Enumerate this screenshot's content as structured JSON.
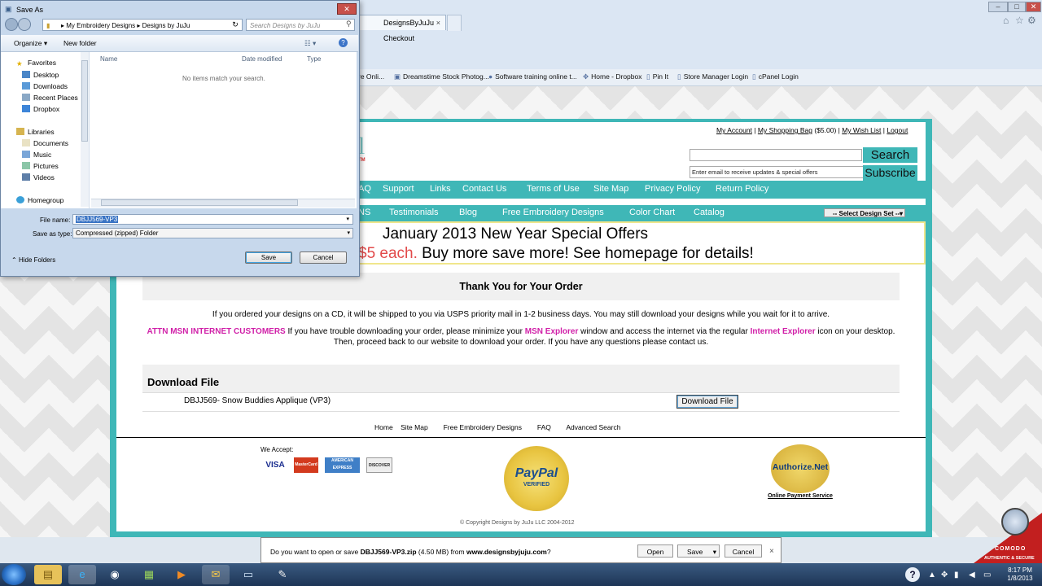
{
  "browser": {
    "tab_title": "DesignsByJuJu Checkout",
    "tab_close": "×",
    "favorites_bar": [
      "re Onli...",
      "Dreamstime Stock Photog...",
      "Software training online t...",
      "Home - Dropbox",
      "Pin It",
      "Store Manager Login",
      "cPanel Login"
    ]
  },
  "site": {
    "logo_fragment": "l",
    "logo_tm": "TM",
    "account_links": {
      "my_account": "My Account",
      "shopping_bag": "My Shopping Bag",
      "bag_total": "($5.00)",
      "wish_list": "My Wish List",
      "logout": "Logout"
    },
    "search_button": "Search",
    "email_placeholder": "Enter email to receive updates & special offers",
    "subscribe_button": "Subscribe",
    "nav1": [
      "AQ",
      "Support",
      "Links",
      "Contact Us",
      "Terms of Use",
      "Site Map",
      "Privacy Policy",
      "Return Policy"
    ],
    "nav2": [
      "NS",
      "Testimonials",
      "Blog",
      "Free Embroidery Designs",
      "Color Chart",
      "Catalog"
    ],
    "design_select": "-- Select Design Set --",
    "offer_line1": "January 2013 New Year Special Offers",
    "offer_line2_red": "$5 each.",
    "offer_line2": " Buy more save more! See homepage for details!"
  },
  "order": {
    "heading": "Thank You for Your Order",
    "cd_notice": "If you ordered your designs on a CD, it will be shipped to you via USPS priority mail in 1-2 business days. You may still download your designs while you wait for it to arrive.",
    "attn_label": "ATTN MSN INTERNET CUSTOMERS",
    "attn_text1": " If you have trouble downloading your order, please minimize your ",
    "msn_explorer": "MSN Explorer",
    "attn_text2": " window and access the internet via the regular ",
    "internet_explorer": "Internet Explorer",
    "attn_text3": " icon on your desktop. Then, proceed back to our website to download your order. If you have any questions please contact us.",
    "download_heading": "Download File",
    "download_item": "DBJJ569- Snow Buddies Applique (VP3)",
    "download_button": "Download File"
  },
  "footer": {
    "links": [
      "Home",
      "Site Map",
      "Free Embroidery Designs",
      "FAQ",
      "Advanced Search"
    ],
    "we_accept": "We Accept:",
    "cards": [
      "VISA",
      "MasterCard",
      "AMERICAN EXPRESS",
      "DISCOVER"
    ],
    "paypal": "PayPal",
    "paypal_verified": "VERIFIED",
    "authnet": "Authorize.Net",
    "authnet_caption": "Online Payment Service",
    "copyright": "© Copyright Designs by JuJu LLC 2004-2012"
  },
  "download_bar": {
    "prefix": "Do you want to open or save ",
    "filename": "DBJJ569-VP3.zip",
    "size": " (4.50 MB) from ",
    "domain": "www.designsbyjuju.com",
    "suffix": "?",
    "open": "Open",
    "save": "Save",
    "cancel": "Cancel",
    "close": "×"
  },
  "dialog": {
    "title": "Save As",
    "close": "✕",
    "path": [
      "My Embroidery Designs",
      "Designs by JuJu"
    ],
    "search_placeholder": "Search Designs by JuJu",
    "organize": "Organize ▾",
    "new_folder": "New folder",
    "nav": {
      "favorites": "Favorites",
      "desktop": "Desktop",
      "downloads": "Downloads",
      "recent": "Recent Places",
      "dropbox": "Dropbox",
      "libraries": "Libraries",
      "documents": "Documents",
      "music": "Music",
      "pictures": "Pictures",
      "videos": "Videos",
      "homegroup": "Homegroup"
    },
    "columns": [
      "Name",
      "Date modified",
      "Type"
    ],
    "empty_message": "No items match your search.",
    "file_name_label": "File name:",
    "file_name_value": "DBJJ569-VP3",
    "save_type_label": "Save as type:",
    "save_type_value": "Compressed (zipped) Folder",
    "hide_folders": "Hide Folders",
    "save_button": "Save",
    "cancel_button": "Cancel"
  },
  "comodo": {
    "brand": "COMODO",
    "tagline": "AUTHENTIC & SECURE"
  },
  "taskbar": {
    "time": "8:17 PM",
    "date": "1/8/2013",
    "help": "?"
  },
  "colors": {
    "teal": "#3fb7b7",
    "magenta": "#d01fa8",
    "offer_red": "#e24a4a"
  }
}
